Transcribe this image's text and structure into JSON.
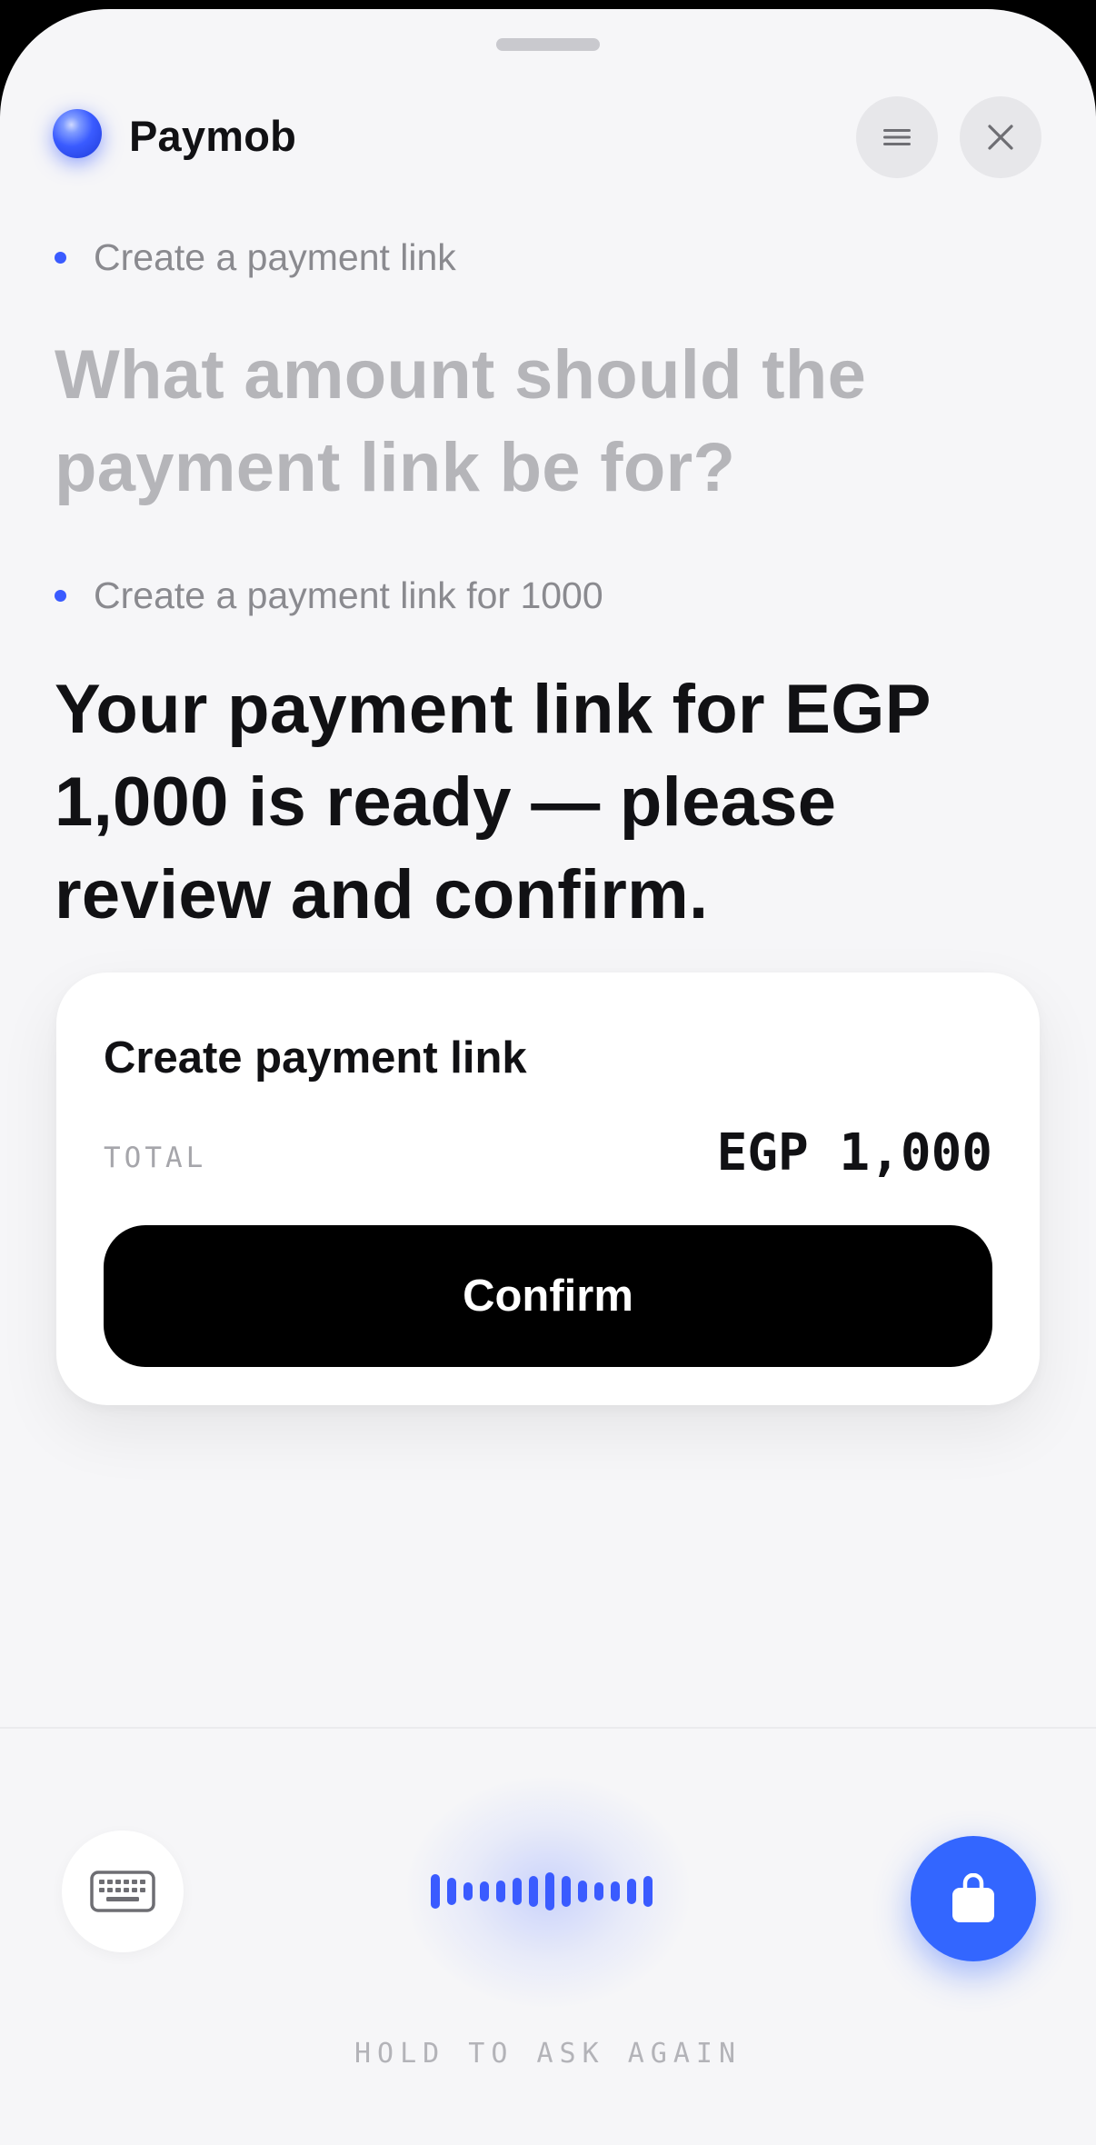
{
  "app": {
    "name": "Paymob",
    "accent_color": "#3366ff"
  },
  "header": {
    "menu_icon": "hamburger-icon",
    "close_icon": "close-icon"
  },
  "conversation": [
    {
      "request": "Create a payment link",
      "reply": "What amount should the payment link be for?"
    },
    {
      "request": "Create a payment link for 1000",
      "reply": "Your payment link for EGP 1,000 is ready — please review and confirm."
    }
  ],
  "card": {
    "title": "Create payment link",
    "total_label": "TOTAL",
    "total_value": "EGP 1,000",
    "confirm_label": "Confirm"
  },
  "bottom": {
    "keyboard_icon": "keyboard-icon",
    "action_icon": "shopping-bag-icon",
    "hint": "HOLD TO ASK AGAIN"
  }
}
